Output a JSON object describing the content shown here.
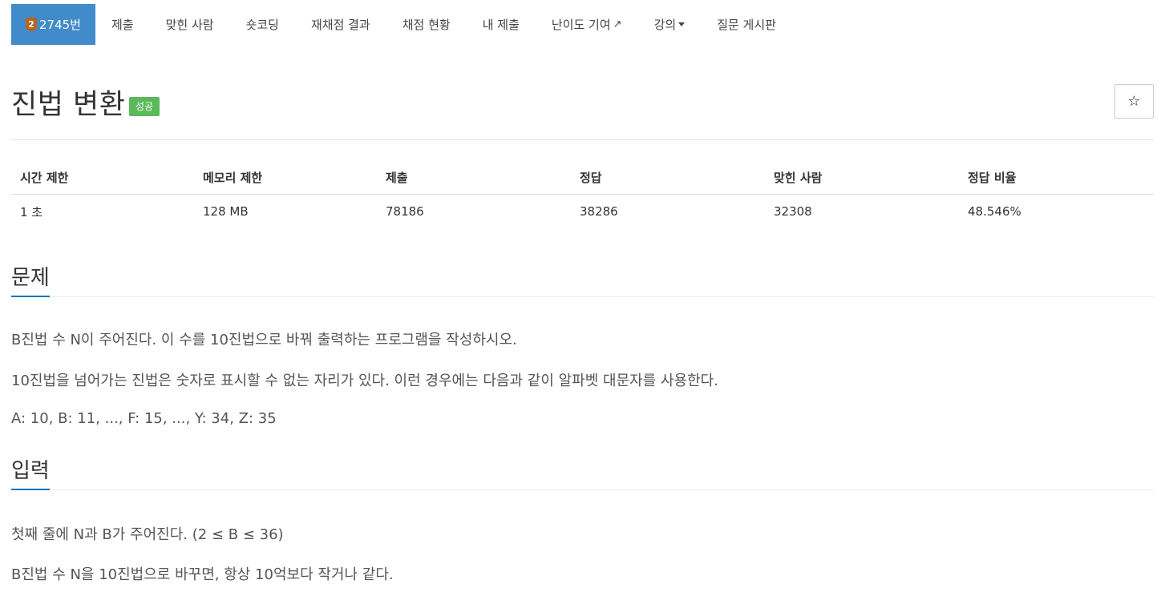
{
  "nav": {
    "problem_number": "2745번",
    "badge_level": "2",
    "items": [
      "제출",
      "맞힌 사람",
      "숏코딩",
      "재채점 결과",
      "채점 현황",
      "내 제출",
      "난이도 기여",
      "강의",
      "질문 게시판"
    ]
  },
  "problem": {
    "title": "진법 변환",
    "status": "성공",
    "star_icon": "☆"
  },
  "stats": {
    "headers": [
      "시간 제한",
      "메모리 제한",
      "제출",
      "정답",
      "맞힌 사람",
      "정답 비율"
    ],
    "values": [
      "1 초",
      "128 MB",
      "78186",
      "38286",
      "32308",
      "48.546%"
    ]
  },
  "sections": {
    "problem_heading": "문제",
    "problem_lines": [
      "B진법 수 N이 주어진다. 이 수를 10진법으로 바꿔 출력하는 프로그램을 작성하시오.",
      "10진법을 넘어가는 진법은 숫자로 표시할 수 없는 자리가 있다. 이런 경우에는 다음과 같이 알파벳 대문자를 사용한다.",
      "A: 10, B: 11, ..., F: 15, ..., Y: 34, Z: 35"
    ],
    "input_heading": "입력",
    "input_lines": [
      "첫째 줄에 N과 B가 주어진다. (2 ≤ B ≤ 36)",
      "B진법 수 N을 10진법으로 바꾸면, 항상 10억보다 작거나 같다."
    ]
  },
  "colors": {
    "nav_active": "#428bca",
    "success": "#5cb85c",
    "section_underline": "#0076c0"
  }
}
